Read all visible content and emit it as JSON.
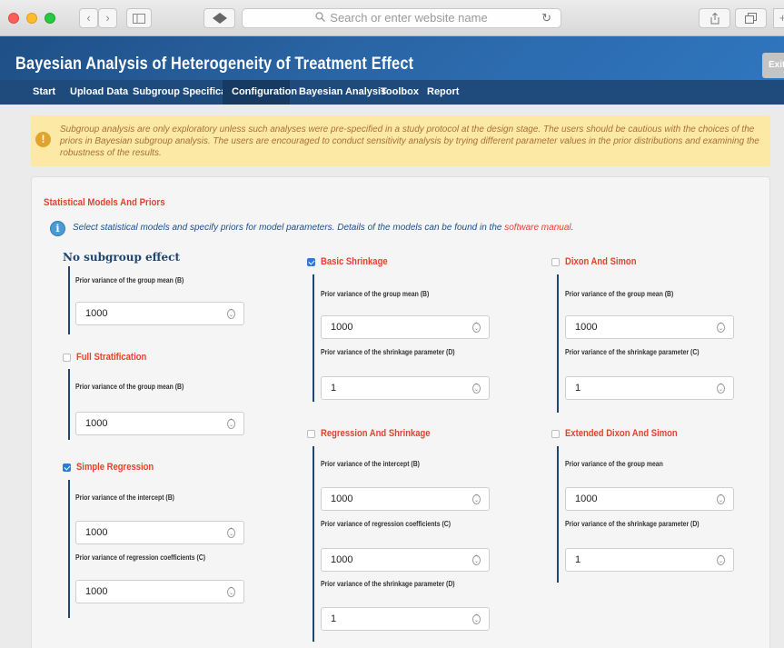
{
  "browser": {
    "search_placeholder": "Search or enter website name",
    "back": "‹",
    "forward": "›",
    "reload": "↻"
  },
  "app": {
    "title": "Bayesian Analysis of Heterogeneity of Treatment Effect",
    "exit_label": "Exit"
  },
  "nav": {
    "tabs": [
      "Start",
      "Upload Data",
      "Subgroup Specification",
      "Configuration",
      "Bayesian Analysis",
      "Toolbox",
      "Report"
    ],
    "active": "Configuration"
  },
  "warning": {
    "icon": "!",
    "text": "Subgroup analysis are only exploratory unless such analyses were pre-specified in a study protocol at the design stage. The users should be cautious with the choices of the priors in Bayesian subgroup analysis. The users are encouraged to conduct sensitivity analysis by trying different parameter values in the prior distributions and examining the robustness of the results."
  },
  "panel": {
    "title": "Statistical Models And Priors",
    "info_icon": "i",
    "info_text": "Select statistical models and specify priors for model parameters. Details of the models can be found in the ",
    "info_link": "software manual",
    "info_end": "."
  },
  "models": {
    "no_subgroup": {
      "title": "No subgroup effect",
      "fields": [
        {
          "label": "Prior variance of the group mean (B)",
          "value": "1000"
        }
      ]
    },
    "full_stratification": {
      "name": "Full Stratification",
      "checked": false,
      "fields": [
        {
          "label": "Prior variance of the group mean (B)",
          "value": "1000"
        }
      ]
    },
    "simple_regression": {
      "name": "Simple Regression",
      "checked": true,
      "fields": [
        {
          "label": "Prior variance of the intercept (B)",
          "value": "1000"
        },
        {
          "label": "Prior variance of regression coefficients (C)",
          "value": "1000"
        }
      ]
    },
    "basic_shrinkage": {
      "name": "Basic Shrinkage",
      "checked": true,
      "fields": [
        {
          "label": "Prior variance of the group mean (B)",
          "value": "1000"
        },
        {
          "label": "Prior variance of the shrinkage parameter (D)",
          "value": "1"
        }
      ]
    },
    "regression_shrinkage": {
      "name": "Regression And Shrinkage",
      "checked": false,
      "fields": [
        {
          "label": "Prior variance of the intercept (B)",
          "value": "1000"
        },
        {
          "label": "Prior variance of regression coefficients (C)",
          "value": "1000"
        },
        {
          "label": "Prior variance of the shrinkage parameter (D)",
          "value": "1"
        }
      ]
    },
    "dixon_simon": {
      "name": "Dixon And Simon",
      "checked": false,
      "fields": [
        {
          "label": "Prior variance of the group mean (B)",
          "value": "1000"
        },
        {
          "label": "Prior variance of the shrinkage parameter (C)",
          "value": "1"
        }
      ]
    },
    "extended_dixon_simon": {
      "name": "Extended Dixon And Simon",
      "checked": false,
      "fields": [
        {
          "label": "Prior variance of the group mean",
          "value": "1000"
        },
        {
          "label": "Prior variance of the shrinkage parameter (D)",
          "value": "1"
        }
      ]
    }
  }
}
